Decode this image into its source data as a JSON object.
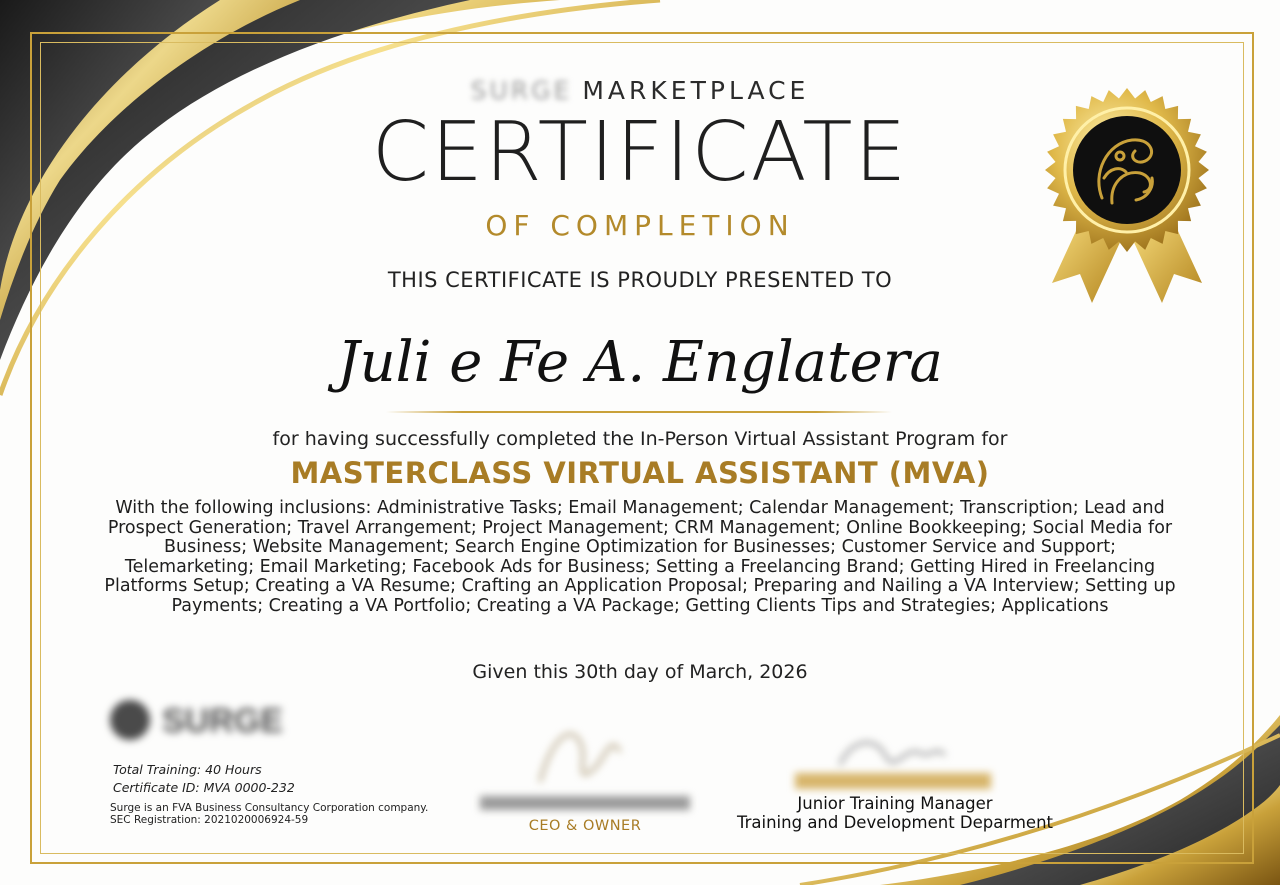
{
  "brand": {
    "name": "SURGE",
    "marketplace": "MARKETPLACE"
  },
  "certificate": {
    "title": "CERTIFICATE",
    "subtitle": "OF COMPLETION",
    "presented_to": "THIS CERTIFICATE IS PROUDLY PRESENTED TO",
    "recipient": "Juli e Fe A. Englatera",
    "completed_text": "for having successfully completed the In-Person Virtual Assistant Program for",
    "program": "MASTERCLASS VIRTUAL ASSISTANT (MVA)",
    "inclusions": "With the following inclusions: Administrative Tasks; Email Management; Calendar Management; Transcription; Lead and Prospect Generation; Travel Arrangement; Project Management; CRM Management; Online Bookkeeping; Social Media for Business; Website Management; Search Engine Optimization for Businesses; Customer Service and Support; Telemarketing; Email Marketing; Facebook Ads for Business; Setting a Freelancing Brand; Getting Hired in Freelancing Platforms Setup; Creating a VA Resume; Crafting an Application Proposal; Preparing and Nailing a VA Interview; Setting up Payments; Creating a VA Portfolio; Creating a VA Package; Getting Clients Tips and Strategies; Applications",
    "given": "Given this 30th day of March, 2026"
  },
  "footer": {
    "logo_text": "SURGE",
    "total_training": "Total Training: 40 Hours",
    "certificate_id": "Certificate ID: MVA 0000-232",
    "company_note": "Surge is an FVA Business Consultancy Corporation company.",
    "sec_registration": "SEC Registration: 2021020006924-59"
  },
  "signatories": [
    {
      "role": "CEO & OWNER"
    },
    {
      "role": "Junior Training Manager",
      "department": "Training and Development Deparment"
    }
  ],
  "seal": {
    "icon": "ornate-wave-emblem-icon"
  },
  "colors": {
    "gold": "#c9a13a",
    "dark_gold": "#a87c25",
    "charcoal": "#2a2a2a",
    "background": "#fdfdfc"
  }
}
